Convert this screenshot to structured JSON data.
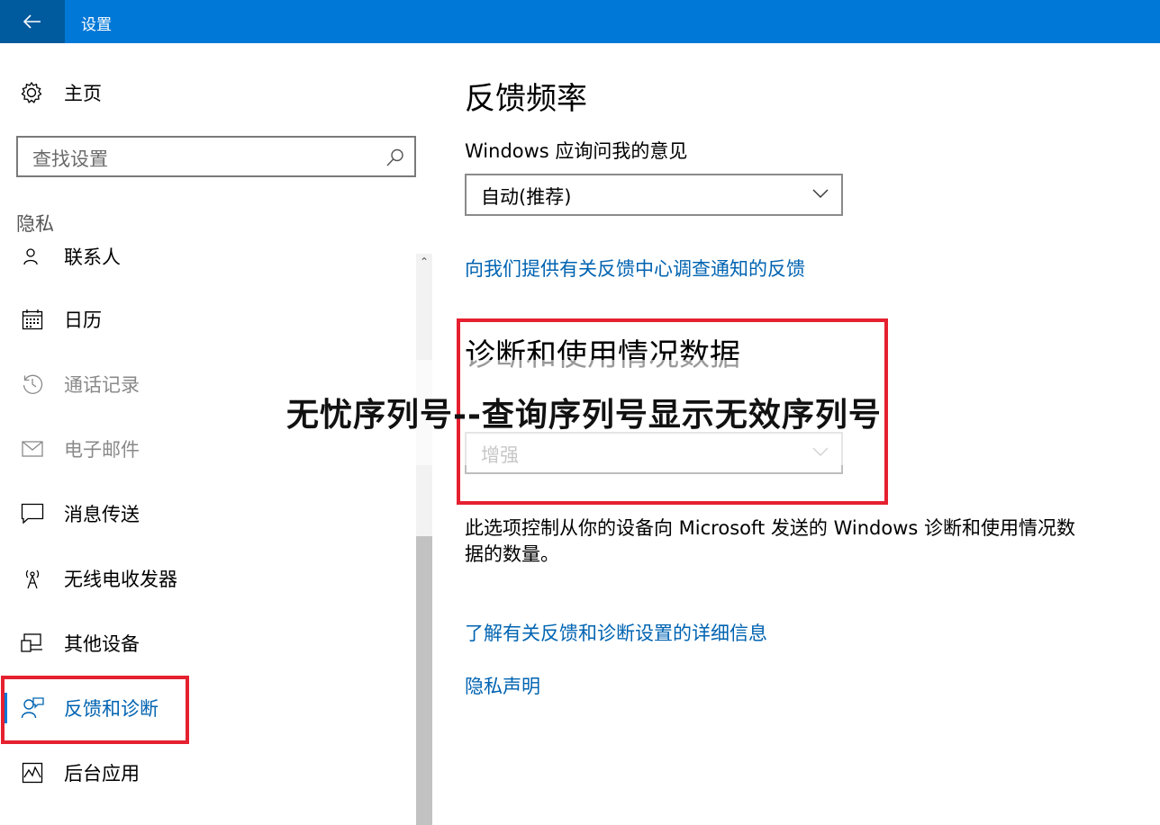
{
  "window": {
    "title": "设置"
  },
  "sidebar": {
    "home_label": "主页",
    "search_placeholder": "查找设置",
    "section_title": "隐私",
    "items": [
      {
        "label": "联系人",
        "icon": "contacts-icon",
        "state": "partial"
      },
      {
        "label": "日历",
        "icon": "calendar-icon",
        "state": "normal"
      },
      {
        "label": "通话记录",
        "icon": "history-icon",
        "state": "dim"
      },
      {
        "label": "电子邮件",
        "icon": "mail-icon",
        "state": "dim"
      },
      {
        "label": "消息传送",
        "icon": "message-icon",
        "state": "normal"
      },
      {
        "label": "无线电收发器",
        "icon": "radio-icon",
        "state": "normal"
      },
      {
        "label": "其他设备",
        "icon": "devices-icon",
        "state": "normal"
      },
      {
        "label": "反馈和诊断",
        "icon": "feedback-icon",
        "state": "active"
      },
      {
        "label": "后台应用",
        "icon": "background-apps-icon",
        "state": "normal"
      }
    ]
  },
  "main": {
    "feedback_title": "反馈频率",
    "feedback_question": "Windows 应询问我的意见",
    "feedback_value": "自动(推荐)",
    "feedback_link": "向我们提供有关反馈中心调查通知的反馈",
    "diag_title": "诊断和使用情况数据",
    "diag_value": "增强",
    "diag_description": "此选项控制从你的设备向 Microsoft 发送的 Windows 诊断和使用情况数据的数量。",
    "learn_more_link": "了解有关反馈和诊断设置的详细信息",
    "privacy_link": "隐私声明"
  },
  "overlay": {
    "watermark": "无忧序列号--查询序列号显示无效序列号"
  },
  "colors": {
    "accent": "#0078d7",
    "highlight": "#e5202f",
    "link": "#0063b1"
  }
}
